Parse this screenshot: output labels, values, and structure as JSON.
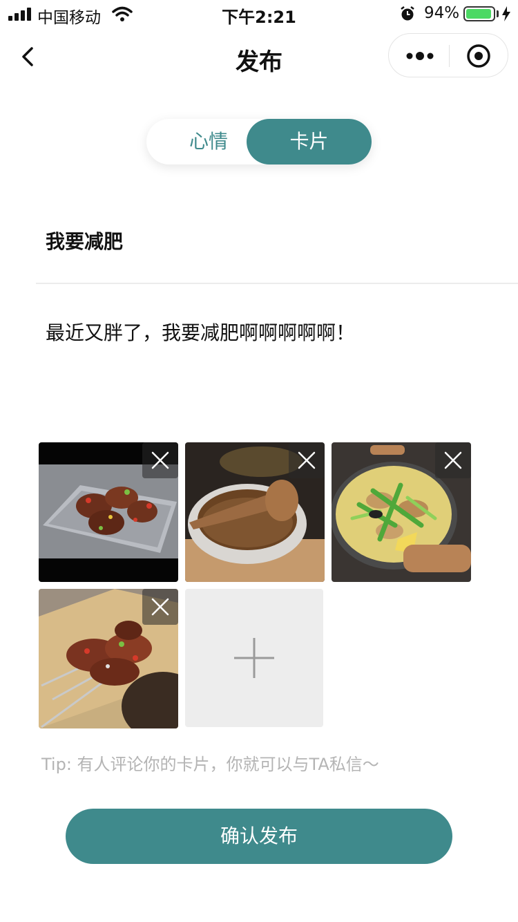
{
  "status_bar": {
    "carrier": "中国移动",
    "time": "下午2:21",
    "battery_percent": "94%",
    "battery_level": 0.94
  },
  "nav": {
    "title": "发布",
    "back_icon": "chevron-left-icon",
    "more_icon": "more-dots-icon",
    "close_icon": "target-circle-icon"
  },
  "toggle": {
    "tabs": [
      "心情",
      "卡片"
    ],
    "active": "卡片",
    "accent_color": "#3f8a8c"
  },
  "form": {
    "title_value": "我要减肥",
    "content_value": "最近又胖了，我要减肥啊啊啊啊啊！"
  },
  "photos": [
    {
      "subject": "grilled-meat-skewers"
    },
    {
      "subject": "clay-pot-rice"
    },
    {
      "subject": "hot-pot-stew"
    },
    {
      "subject": "grilled-meat-on-board"
    }
  ],
  "add_photo_icon": "plus-icon",
  "tip": "Tip: 有人评论你的卡片，你就可以与TA私信～",
  "confirm_button": "确认发布"
}
